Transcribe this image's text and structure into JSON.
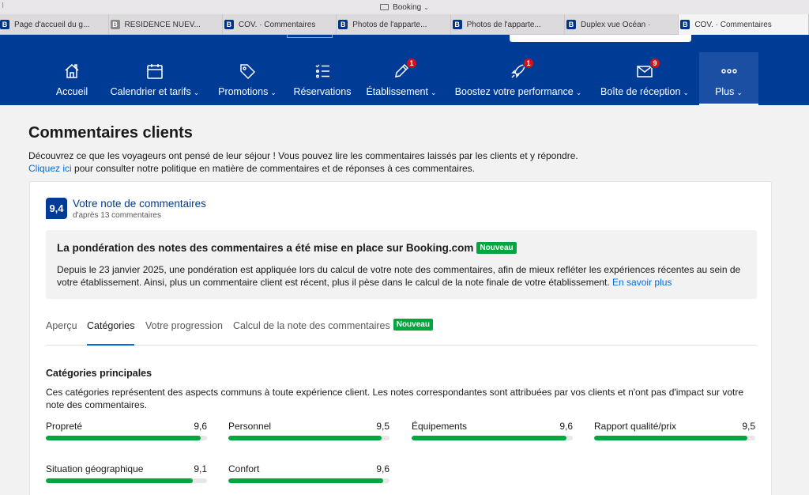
{
  "window": {
    "title": "Booking"
  },
  "browser_tabs": [
    {
      "label": "Page d'accueil du g...",
      "favicon": "B",
      "favicon_style": "booking"
    },
    {
      "label": "RESIDENCE NUEV...",
      "favicon": "B",
      "favicon_style": "grey"
    },
    {
      "label": "COV. · Commentaires",
      "favicon": "B",
      "favicon_style": "booking"
    },
    {
      "label": "Photos de l'apparte...",
      "favicon": "B",
      "favicon_style": "booking"
    },
    {
      "label": "Photos de l'apparte...",
      "favicon": "B",
      "favicon_style": "booking"
    },
    {
      "label": "Duplex vue Océan ·",
      "favicon": "B",
      "favicon_style": "booking"
    },
    {
      "label": "COV. · Commentaires",
      "favicon": "B",
      "favicon_style": "booking",
      "active": true
    }
  ],
  "nav": {
    "items": [
      {
        "label": "Accueil",
        "icon": "house-icon",
        "caret": false
      },
      {
        "label": "Calendrier et tarifs",
        "icon": "calendar-icon",
        "caret": true
      },
      {
        "label": "Promotions",
        "icon": "tag-icon",
        "caret": true
      },
      {
        "label": "Réservations",
        "icon": "list-icon",
        "caret": false
      },
      {
        "label": "Établissement",
        "icon": "pencil-icon",
        "caret": true,
        "badge": "1"
      },
      {
        "label": "Boostez votre performance",
        "icon": "rocket-icon",
        "caret": true,
        "badge": "1"
      },
      {
        "label": "Boîte de réception",
        "icon": "envelope-icon",
        "caret": true,
        "badge": "9"
      },
      {
        "label": "Plus",
        "icon": "more-dots-icon",
        "caret": true,
        "active": true
      }
    ]
  },
  "page": {
    "title": "Commentaires clients",
    "intro_line1": "Découvrez ce que les voyageurs ont pensé de leur séjour ! Vous pouvez lire les commentaires laissés par les clients et y répondre.",
    "intro_link": "Cliquez ici",
    "intro_line2": " pour consulter notre politique en matière de commentaires et de réponses à ces commentaires."
  },
  "score": {
    "value": "9,4",
    "title": "Votre note de commentaires",
    "subtitle": "d'après 13 commentaires"
  },
  "notice": {
    "title": "La pondération des notes des commentaires a été mise en place sur Booking.com",
    "badge": "Nouveau",
    "body": "Depuis le 23 janvier 2025, une pondération est appliquée lors du calcul de votre note des commentaires, afin de mieux refléter les expériences récentes au sein de votre établissement. Ainsi, plus un commentaire client est récent, plus il pèse dans le calcul de la note finale de votre établissement. ",
    "link": "En savoir plus"
  },
  "content_tabs": [
    {
      "label": "Aperçu"
    },
    {
      "label": "Catégories",
      "active": true
    },
    {
      "label": "Votre progression"
    },
    {
      "label": "Calcul de la note des commentaires",
      "badge": "Nouveau"
    }
  ],
  "categories": {
    "title": "Catégories principales",
    "description": "Ces catégories représentent des aspects communs à toute expérience client. Les notes correspondantes sont attribuées par vos clients et n'ont pas d'impact sur votre note des commentaires.",
    "items": [
      {
        "label": "Propreté",
        "score": "9,6",
        "fraction": 0.96
      },
      {
        "label": "Personnel",
        "score": "9,5",
        "fraction": 0.95
      },
      {
        "label": "Équipements",
        "score": "9,6",
        "fraction": 0.96
      },
      {
        "label": "Rapport qualité/prix",
        "score": "9,5",
        "fraction": 0.95
      },
      {
        "label": "Situation géographique",
        "score": "9,1",
        "fraction": 0.91
      },
      {
        "label": "Confort",
        "score": "9,6",
        "fraction": 0.96
      }
    ]
  },
  "colors": {
    "brand_blue": "#003b95",
    "link_blue": "#006ce4",
    "bar_green": "#00a63e",
    "badge_red": "#d4111e"
  }
}
